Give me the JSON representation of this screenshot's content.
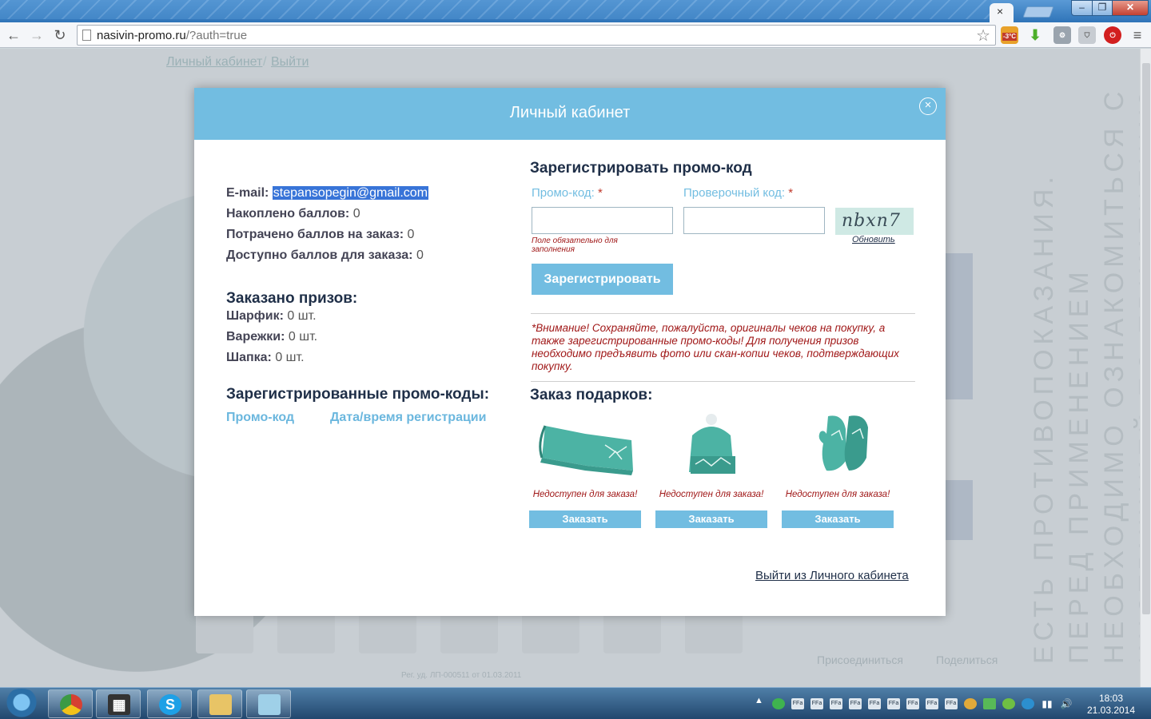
{
  "browser": {
    "url_host": "nasivin-promo.ru",
    "url_path": "/?auth=true",
    "weather_badge": "-3°C"
  },
  "background": {
    "links": [
      "Личный кабинет",
      "Выйти"
    ],
    "link_separator": "/",
    "vertical_text": "ЕСТЬ ПРОТИВОПОКАЗАНИЯ. ПЕРЕД ПРИМЕНЕНИЕМ НЕОБХОДИМО ОЗНАКОМИТЬСЯ С ИНСТРУКЦИЕЙ ПО ПРИМЕНЕНИЮ",
    "reg_number": "Рег. уд. ЛП-000511 от 01.03.2011",
    "join_label": "Присоединиться",
    "share_label": "Поделиться"
  },
  "modal": {
    "title": "Личный кабинет",
    "close_glyph": "×",
    "account": {
      "email_label": "E-mail:",
      "email_value": "stepansopegin@gmail.com",
      "points_accumulated_label": "Накоплено баллов:",
      "points_accumulated_value": "0",
      "points_spent_label": "Потрачено баллов на заказ:",
      "points_spent_value": "0",
      "points_available_label": "Доступно баллов для заказа:",
      "points_available_value": "0"
    },
    "prizes": {
      "title": "Заказано призов:",
      "items": [
        {
          "label": "Шарфик:",
          "value": "0 шт."
        },
        {
          "label": "Варежки:",
          "value": "0 шт."
        },
        {
          "label": "Шапка:",
          "value": "0 шт."
        }
      ]
    },
    "registered_codes": {
      "title": "Зарегистрированные промо-коды:",
      "col_code": "Промо-код",
      "col_datetime": "Дата/время регистрации"
    },
    "register": {
      "title": "Зарегистрировать промо-код",
      "promo_label": "Промо-код:",
      "check_label": "Проверочный код:",
      "required_mark": "*",
      "promo_value": "",
      "check_value": "",
      "error": "Поле обязательно для заполнения",
      "captcha_text": "nbxn7",
      "refresh_label": "Обновить",
      "submit_label": "Зарегистрировать"
    },
    "notice": "*Внимание! Сохраняйте, пожалуйста, оригиналы чеков на покупку, а также зарегистрированные промо-коды! Для получения призов необходимо предъявить фото или скан-копии чеков, подтверждающих покупку.",
    "gifts": {
      "title": "Заказ подарков:",
      "items": [
        {
          "icon": "scarf-icon",
          "status": "Недоступен для заказа!",
          "button": "Заказать"
        },
        {
          "icon": "hat-icon",
          "status": "Недоступен для заказа!",
          "button": "Заказать"
        },
        {
          "icon": "mittens-icon",
          "status": "Недоступен для заказа!",
          "button": "Заказать"
        }
      ]
    },
    "logout_label": "Выйти из Личного кабинета",
    "colors": {
      "accent": "#72bde1",
      "title": "#1f2f48",
      "error": "#a01818"
    }
  },
  "taskbar": {
    "time": "18:03",
    "date": "21.03.2014"
  }
}
